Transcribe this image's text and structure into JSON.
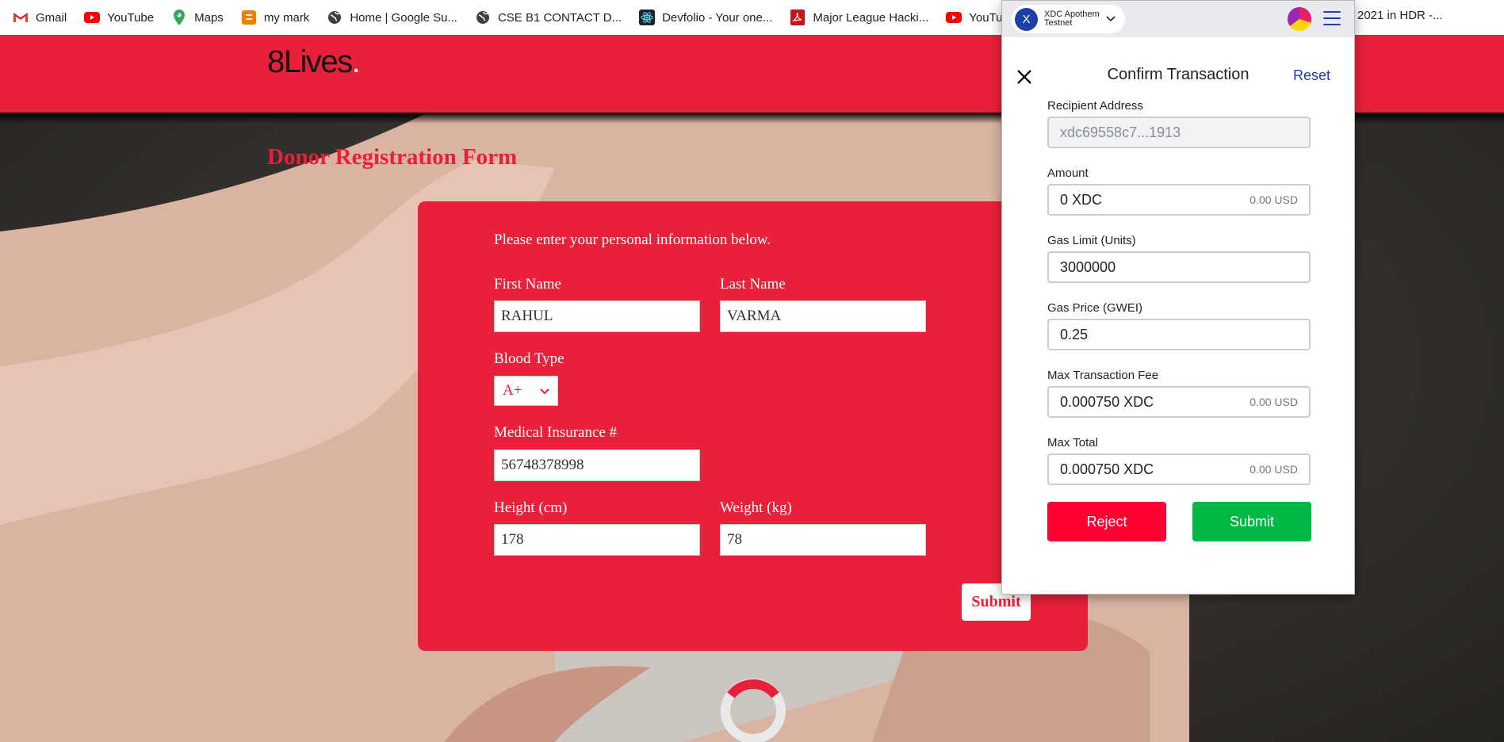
{
  "bookmarks": [
    {
      "label": "Gmail",
      "icon": "gmail-icon"
    },
    {
      "label": "YouTube",
      "icon": "youtube-icon"
    },
    {
      "label": "Maps",
      "icon": "maps-icon"
    },
    {
      "label": "my mark",
      "icon": "blogger-icon"
    },
    {
      "label": "Home | Google Su...",
      "icon": "globe-icon"
    },
    {
      "label": "CSE B1 CONTACT D...",
      "icon": "globe-icon"
    },
    {
      "label": "Devfolio - Your one...",
      "icon": "react-icon"
    },
    {
      "label": "Major League Hacki...",
      "icon": "pdf-icon"
    },
    {
      "label": "YouTube",
      "icon": "youtube-icon"
    }
  ],
  "bookmark_overflow_text": "2021 in HDR -...",
  "site": {
    "logo": "8Lives",
    "logo_dot": ".",
    "form_title": "Donor Registration Form",
    "brand_color": "#e8203a"
  },
  "form": {
    "intro": "Please enter your personal information below.",
    "first_name_label": "First Name",
    "first_name_value": "RAHUL",
    "last_name_label": "Last Name",
    "last_name_value": "VARMA",
    "blood_type_label": "Blood Type",
    "blood_type_value": "A+",
    "insurance_label": "Medical Insurance #",
    "insurance_value": "56748378998",
    "height_label": "Height (cm)",
    "height_value": "178",
    "weight_label": "Weight (kg)",
    "weight_value": "78",
    "submit_label": "Submit"
  },
  "wallet": {
    "network_line1": "XDC Apothem",
    "network_line2": "Testnet",
    "network_icon_letter": "X",
    "title": "Confirm Transaction",
    "reset_label": "Reset",
    "recipient_label": "Recipient Address",
    "recipient_value": "xdc69558c7...1913",
    "amount_label": "Amount",
    "amount_value": "0 XDC",
    "amount_usd": "0.00 USD",
    "gas_limit_label": "Gas Limit (Units)",
    "gas_limit_value": "3000000",
    "gas_price_label": "Gas Price (GWEI)",
    "gas_price_value": "0.25",
    "max_fee_label": "Max Transaction Fee",
    "max_fee_value": "0.000750 XDC",
    "max_fee_usd": "0.00 USD",
    "max_total_label": "Max Total",
    "max_total_value": "0.000750 XDC",
    "max_total_usd": "0.00 USD",
    "reject_label": "Reject",
    "submit_label": "Submit",
    "reject_color": "#ff0033",
    "submit_color": "#00b843"
  }
}
